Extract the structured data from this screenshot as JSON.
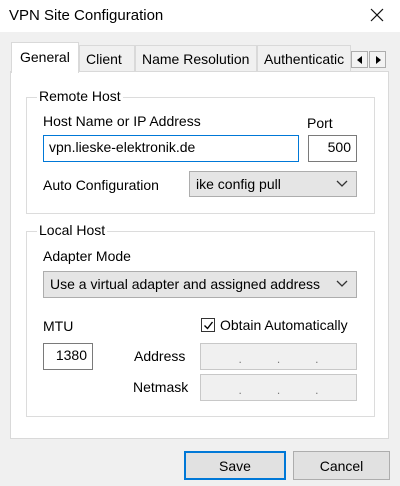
{
  "window": {
    "title": "VPN Site Configuration"
  },
  "tabs": [
    {
      "label": "General",
      "active": true
    },
    {
      "label": "Client",
      "active": false
    },
    {
      "label": "Name Resolution",
      "active": false
    },
    {
      "label": "Authenticatic",
      "active": false
    }
  ],
  "remote_host": {
    "legend": "Remote Host",
    "host_label": "Host Name or IP Address",
    "host_value": "vpn.lieske-elektronik.de",
    "port_label": "Port",
    "port_value": "500",
    "auto_config_label": "Auto Configuration",
    "auto_config_value": "ike config pull"
  },
  "local_host": {
    "legend": "Local Host",
    "adapter_mode_label": "Adapter Mode",
    "adapter_mode_value": "Use a virtual adapter and assigned address",
    "mtu_label": "MTU",
    "mtu_value": "1380",
    "obtain_auto_label": "Obtain Automatically",
    "obtain_auto_checked": true,
    "address_label": "Address",
    "netmask_label": "Netmask"
  },
  "buttons": {
    "save": "Save",
    "cancel": "Cancel"
  },
  "icons": {
    "close": "close-icon",
    "chevron": "chevron-down-icon",
    "scroll_left": "arrow-left-icon",
    "scroll_right": "arrow-right-icon",
    "check": "check-icon"
  },
  "colors": {
    "focus": "#0078d7",
    "panel": "#ffffff",
    "dialog": "#f0f0f0"
  }
}
